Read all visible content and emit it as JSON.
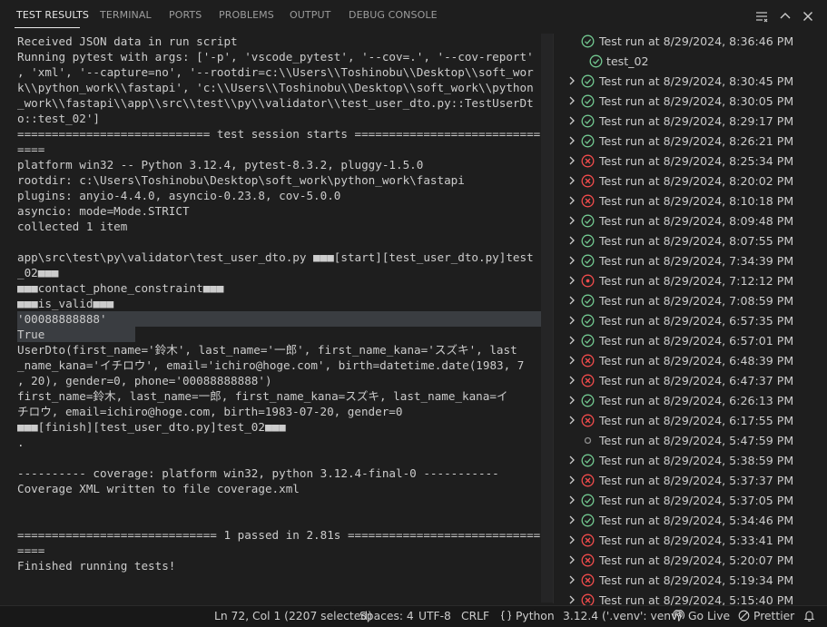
{
  "panel_tabs": [
    {
      "label": "TEST RESULTS",
      "active": true
    },
    {
      "label": "TERMINAL",
      "active": false
    },
    {
      "label": "PORTS",
      "active": false
    },
    {
      "label": "PROBLEMS",
      "active": false
    },
    {
      "label": "OUTPUT",
      "active": false
    },
    {
      "label": "DEBUG CONSOLE",
      "active": false
    }
  ],
  "output_lines": [
    "Received JSON data in run script",
    "Running pytest with args: ['-p', 'vscode_pytest', '--cov=.', '--cov-report'",
    ", 'xml', '--capture=no', '--rootdir=c:\\\\Users\\\\Toshinobu\\\\Desktop\\\\soft_wor",
    "k\\\\python_work\\\\fastapi', 'c:\\\\Users\\\\Toshinobu\\\\Desktop\\\\soft_work\\\\python",
    "_work\\\\fastapi\\\\app\\\\src\\\\test\\\\py\\\\validator\\\\test_user_dto.py::TestUserDt",
    "o::test_02']",
    "============================ test session starts ===========================",
    "====",
    "platform win32 -- Python 3.12.4, pytest-8.3.2, pluggy-1.5.0",
    "rootdir: c:\\Users\\Toshinobu\\Desktop\\soft_work\\python_work\\fastapi",
    "plugins: anyio-4.4.0, asyncio-0.23.8, cov-5.0.0",
    "asyncio: mode=Mode.STRICT",
    "collected 1 item",
    "",
    "app\\src\\test\\py\\validator\\test_user_dto.py ■■■[start][test_user_dto.py]test",
    "_02■■■",
    "■■■contact_phone_constraint■■■",
    "■■■is_valid■■■",
    "'00088888888'",
    "True",
    "UserDto(first_name='鈴木', last_name='一郎', first_name_kana='スズキ', last",
    "_name_kana='イチロウ', email='ichiro@hoge.com', birth=datetime.date(1983, 7",
    ", 20), gender=0, phone='00088888888')",
    "first_name=鈴木, last_name=一郎, first_name_kana=スズキ, last_name_kana=イ",
    "チロウ, email=ichiro@hoge.com, birth=1983-07-20, gender=0",
    "■■■[finish][test_user_dto.py]test_02■■■",
    ".",
    "",
    "---------- coverage: platform win32, python 3.12.4-final-0 -----------",
    "Coverage XML written to file coverage.xml",
    "",
    "",
    "============================= 1 passed in 2.81s ============================",
    "====",
    "Finished running tests!"
  ],
  "test_runs": [
    {
      "label": "Test run at 8/29/2024, 8:36:46 PM",
      "status": "passed",
      "chevron": false,
      "child": false
    },
    {
      "label": "test_02",
      "status": "passed",
      "chevron": false,
      "child": true
    },
    {
      "label": "Test run at 8/29/2024, 8:30:45 PM",
      "status": "passed",
      "chevron": true,
      "child": false
    },
    {
      "label": "Test run at 8/29/2024, 8:30:05 PM",
      "status": "passed",
      "chevron": true,
      "child": false
    },
    {
      "label": "Test run at 8/29/2024, 8:29:17 PM",
      "status": "passed",
      "chevron": true,
      "child": false
    },
    {
      "label": "Test run at 8/29/2024, 8:26:21 PM",
      "status": "passed",
      "chevron": true,
      "child": false
    },
    {
      "label": "Test run at 8/29/2024, 8:25:34 PM",
      "status": "failed",
      "chevron": true,
      "child": false
    },
    {
      "label": "Test run at 8/29/2024, 8:20:02 PM",
      "status": "failed",
      "chevron": true,
      "child": false
    },
    {
      "label": "Test run at 8/29/2024, 8:10:18 PM",
      "status": "failed",
      "chevron": true,
      "child": false
    },
    {
      "label": "Test run at 8/29/2024, 8:09:48 PM",
      "status": "passed",
      "chevron": true,
      "child": false
    },
    {
      "label": "Test run at 8/29/2024, 8:07:55 PM",
      "status": "passed",
      "chevron": true,
      "child": false
    },
    {
      "label": "Test run at 8/29/2024, 7:34:39 PM",
      "status": "passed",
      "chevron": true,
      "child": false
    },
    {
      "label": "Test run at 8/29/2024, 7:12:12 PM",
      "status": "errored",
      "chevron": true,
      "child": false
    },
    {
      "label": "Test run at 8/29/2024, 7:08:59 PM",
      "status": "passed",
      "chevron": true,
      "child": false
    },
    {
      "label": "Test run at 8/29/2024, 6:57:35 PM",
      "status": "passed",
      "chevron": true,
      "child": false
    },
    {
      "label": "Test run at 8/29/2024, 6:57:01 PM",
      "status": "passed",
      "chevron": true,
      "child": false
    },
    {
      "label": "Test run at 8/29/2024, 6:48:39 PM",
      "status": "failed",
      "chevron": true,
      "child": false
    },
    {
      "label": "Test run at 8/29/2024, 6:47:37 PM",
      "status": "failed",
      "chevron": true,
      "child": false
    },
    {
      "label": "Test run at 8/29/2024, 6:26:13 PM",
      "status": "passed",
      "chevron": true,
      "child": false
    },
    {
      "label": "Test run at 8/29/2024, 6:17:55 PM",
      "status": "failed",
      "chevron": true,
      "child": false
    },
    {
      "label": "Test run at 8/29/2024, 5:47:59 PM",
      "status": "unset",
      "chevron": false,
      "child": false
    },
    {
      "label": "Test run at 8/29/2024, 5:38:59 PM",
      "status": "passed",
      "chevron": true,
      "child": false
    },
    {
      "label": "Test run at 8/29/2024, 5:37:37 PM",
      "status": "failed",
      "chevron": true,
      "child": false
    },
    {
      "label": "Test run at 8/29/2024, 5:37:05 PM",
      "status": "passed",
      "chevron": true,
      "child": false
    },
    {
      "label": "Test run at 8/29/2024, 5:34:46 PM",
      "status": "passed",
      "chevron": true,
      "child": false
    },
    {
      "label": "Test run at 8/29/2024, 5:33:41 PM",
      "status": "failed",
      "chevron": true,
      "child": false
    },
    {
      "label": "Test run at 8/29/2024, 5:20:07 PM",
      "status": "failed",
      "chevron": true,
      "child": false
    },
    {
      "label": "Test run at 8/29/2024, 5:19:34 PM",
      "status": "failed",
      "chevron": true,
      "child": false
    },
    {
      "label": "Test run at 8/29/2024, 5:15:40 PM",
      "status": "failed",
      "chevron": true,
      "child": false
    }
  ],
  "statusbar": {
    "cursor": "Ln 72, Col 1 (2207 selected)",
    "spaces": "Spaces: 4",
    "encoding": "UTF-8",
    "eol": "CRLF",
    "language": "Python",
    "interpreter": "3.12.4 ('.venv': venv)",
    "golive": "Go Live",
    "prettier": "Prettier"
  },
  "icons": {
    "toolbar": [
      "list-view-icon",
      "chevron-up-icon",
      "close-icon"
    ],
    "status": {
      "passed": "check-circle-icon",
      "failed": "x-circle-icon",
      "errored": "dot-circle-icon",
      "unset": "hollow-circle-icon"
    }
  },
  "colors": {
    "passed": "#73c991",
    "failed": "#f14c4c",
    "unset": "#8c8c8c",
    "selection": "#3a3d41",
    "background": "#1e1e1e",
    "statusbar": "#181818"
  }
}
